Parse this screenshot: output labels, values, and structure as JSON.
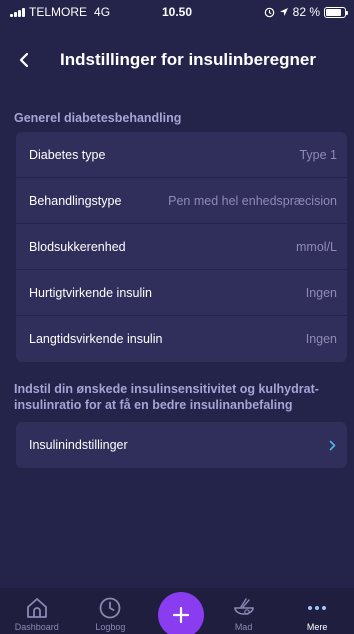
{
  "status_bar": {
    "carrier": "TELMORE",
    "network": "4G",
    "time": "10.50",
    "battery": "82 %",
    "battery_level": 0.82
  },
  "header": {
    "back_icon": "chevron-left-icon",
    "title": "Indstillinger for insulinberegner"
  },
  "general_section": {
    "title": "Generel diabetesbehandling",
    "rows": [
      {
        "label": "Diabetes type",
        "value": "Type 1"
      },
      {
        "label": "Behandlingstype",
        "value": "Pen med hel enhedspræcision"
      },
      {
        "label": "Blodsukkerenhed",
        "value": "mmol/L"
      },
      {
        "label": "Hurtigtvirkende insulin",
        "value": "Ingen"
      },
      {
        "label": "Langtidsvirkende insulin",
        "value": "Ingen"
      }
    ]
  },
  "insulin_section": {
    "title": "Indstil din ønskede insulinsensitivitet og kulhydrat-insulinratio for at få en bedre insulinanbefaling",
    "title_line1": "Indstil din ønskede insulinsensitivitet og kulhydrat-",
    "title_line2": "insulinratio for at få en bedre insulinanbefaling",
    "row_label": "Insulinindstillinger"
  },
  "tab_bar": {
    "tabs": [
      {
        "label": "Dashboard",
        "icon": "home-icon"
      },
      {
        "label": "Logbog",
        "icon": "clock-icon"
      },
      {
        "label": "Mad",
        "icon": "bowl-icon"
      },
      {
        "label": "Mere",
        "icon": "more-dots-icon"
      }
    ],
    "add_icon": "plus-icon",
    "active": "Mere"
  },
  "colors": {
    "background": "#24234a",
    "card": "#302e5a",
    "section_title": "#a6a4d6",
    "value_text": "#8e8cb4",
    "accent": "#8a3cf0",
    "chevron": "#4fb6e8"
  }
}
